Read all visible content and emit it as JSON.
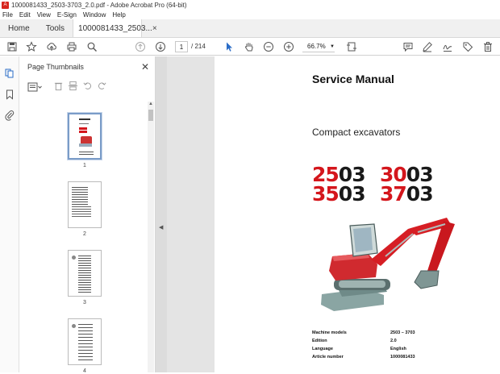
{
  "window": {
    "title": "1000081433_2503-3703_2.0.pdf - Adobe Acrobat Pro (64-bit)"
  },
  "menu": [
    "File",
    "Edit",
    "View",
    "E-Sign",
    "Window",
    "Help"
  ],
  "tabs": {
    "home": "Home",
    "tools": "Tools",
    "document": "1000081433_2503...",
    "close": "×"
  },
  "toolbar": {
    "current_page": "1",
    "total_pages": "/ 214",
    "zoom": "66.7%"
  },
  "panel": {
    "title": "Page Thumbnails",
    "thumbnails": [
      {
        "number": "1",
        "selected": true
      },
      {
        "number": "2",
        "selected": false
      },
      {
        "number": "3",
        "selected": false
      },
      {
        "number": "4",
        "selected": false
      }
    ]
  },
  "document": {
    "title": "Service Manual",
    "subtitle": "Compact excavators",
    "models": [
      {
        "left": "25",
        "right": "03"
      },
      {
        "left": "30",
        "right": "03"
      },
      {
        "left": "35",
        "right": "03"
      },
      {
        "left": "37",
        "right": "03"
      }
    ],
    "meta": [
      {
        "key": "Machine models",
        "value": "2503 – 3703"
      },
      {
        "key": "Edition",
        "value": "2.0"
      },
      {
        "key": "Language",
        "value": "English"
      },
      {
        "key": "Article number",
        "value": "1000081433"
      }
    ]
  },
  "colors": {
    "brand_red": "#d4161c",
    "acrobat_red": "#d7261e",
    "panel_bg": "#ffffff",
    "canvas_bg": "#e4e4e4"
  },
  "icons": [
    "pdf-icon",
    "save-icon",
    "star-icon",
    "upload-icon",
    "print-icon",
    "zoom-search-icon",
    "page-up-icon",
    "page-down-icon",
    "cursor-icon",
    "hand-icon",
    "zoom-out-icon",
    "zoom-in-icon",
    "fit-icon",
    "comment-icon",
    "pen-icon",
    "sign-icon",
    "tag-icon",
    "trash-icon"
  ]
}
